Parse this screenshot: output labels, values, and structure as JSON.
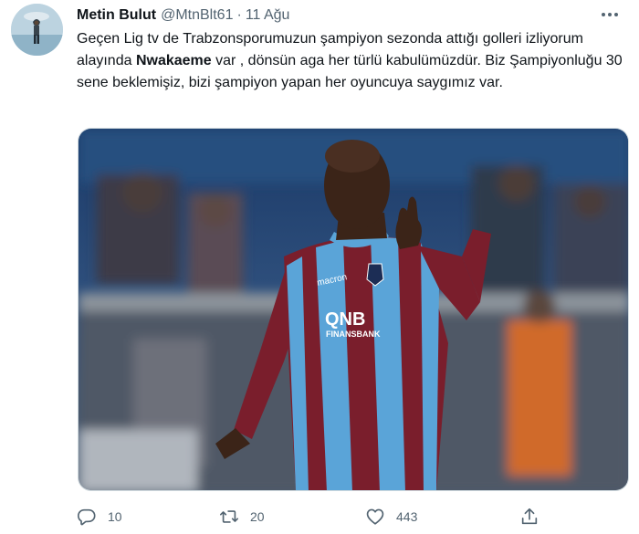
{
  "tweet": {
    "author_name": "Metin Bulut",
    "handle": "@MtnBlt61",
    "separator": "·",
    "date": "11 Ağu",
    "text_part1": "Geçen Lig tv de Trabzonsporumuzun şampiyon sezonda attığı golleri izliyorum alayında ",
    "text_bold": "Nwakaeme",
    "text_part2": " var , dönsün aga her türlü kabulümüzdür. Biz Şampiyonluğu 30 sene beklemişiz, bizi şampiyon yapan her oyuncuya saygımız var."
  },
  "media": {
    "jersey_brand": "macron",
    "jersey_sponsor_line1": "QNB",
    "jersey_sponsor_line2": "FINANSBANK",
    "colors": {
      "claret": "#7a1e2c",
      "sky_blue": "#5aa4d8",
      "skin": "#3b2418",
      "stadium_blue": "#1d3f6e"
    }
  },
  "actions": {
    "reply": {
      "icon": "reply-icon",
      "count": "10"
    },
    "retweet": {
      "icon": "retweet-icon",
      "count": "20"
    },
    "like": {
      "icon": "heart-icon",
      "count": "443"
    },
    "share": {
      "icon": "share-icon"
    }
  },
  "icons": {
    "more": "more-options-icon"
  }
}
